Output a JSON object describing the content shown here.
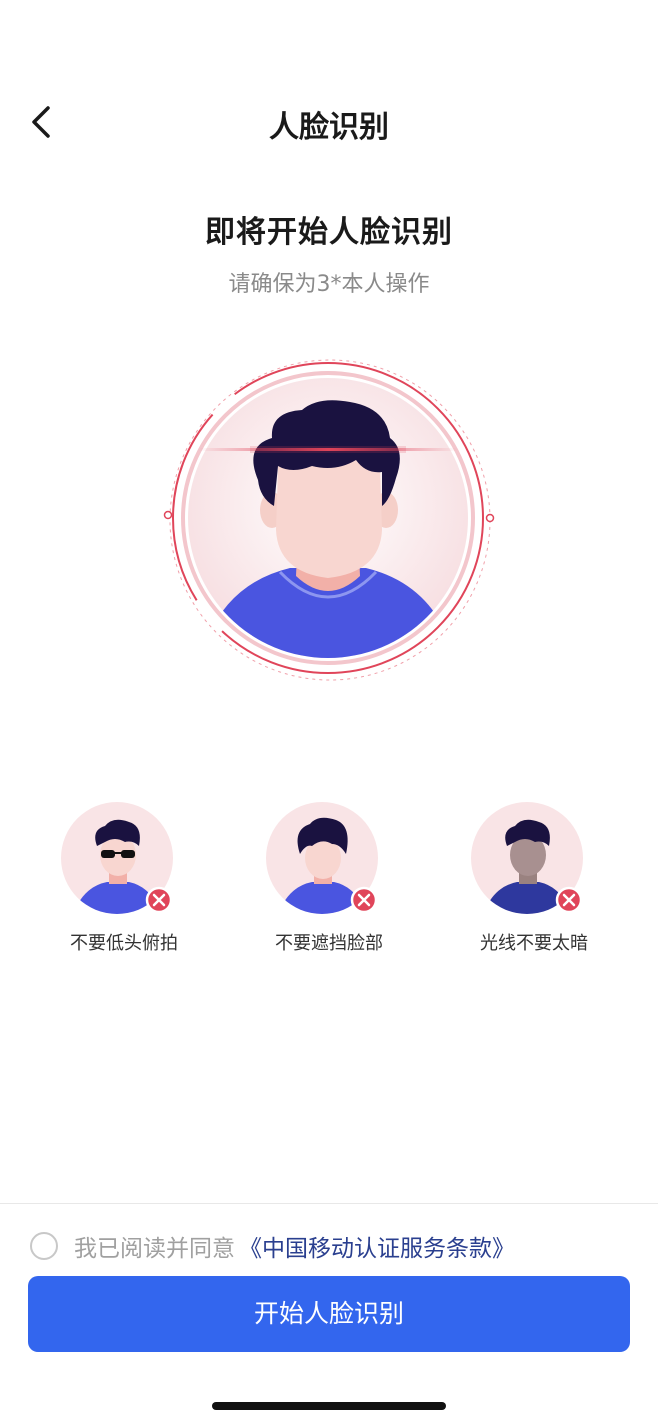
{
  "nav": {
    "title": "人脸识别",
    "back_icon": "chevron-left-icon"
  },
  "intro": {
    "title": "即将开始人脸识别",
    "subtitle": "请确保为3*本人操作"
  },
  "tips": [
    {
      "label": "不要低头俯拍",
      "icon": "error-x-icon"
    },
    {
      "label": "不要遮挡脸部",
      "icon": "error-x-icon"
    },
    {
      "label": "光线不要太暗",
      "icon": "error-x-icon"
    }
  ],
  "agreement": {
    "prefix": "我已阅读并同意",
    "link": "《中国移动认证服务条款》",
    "checked": false
  },
  "start_button": {
    "label": "开始人脸识别"
  },
  "colors": {
    "primary": "#3366ee",
    "accent_red": "#e0455a",
    "shirt": "#4a55e0",
    "hair": "#1a1240"
  }
}
